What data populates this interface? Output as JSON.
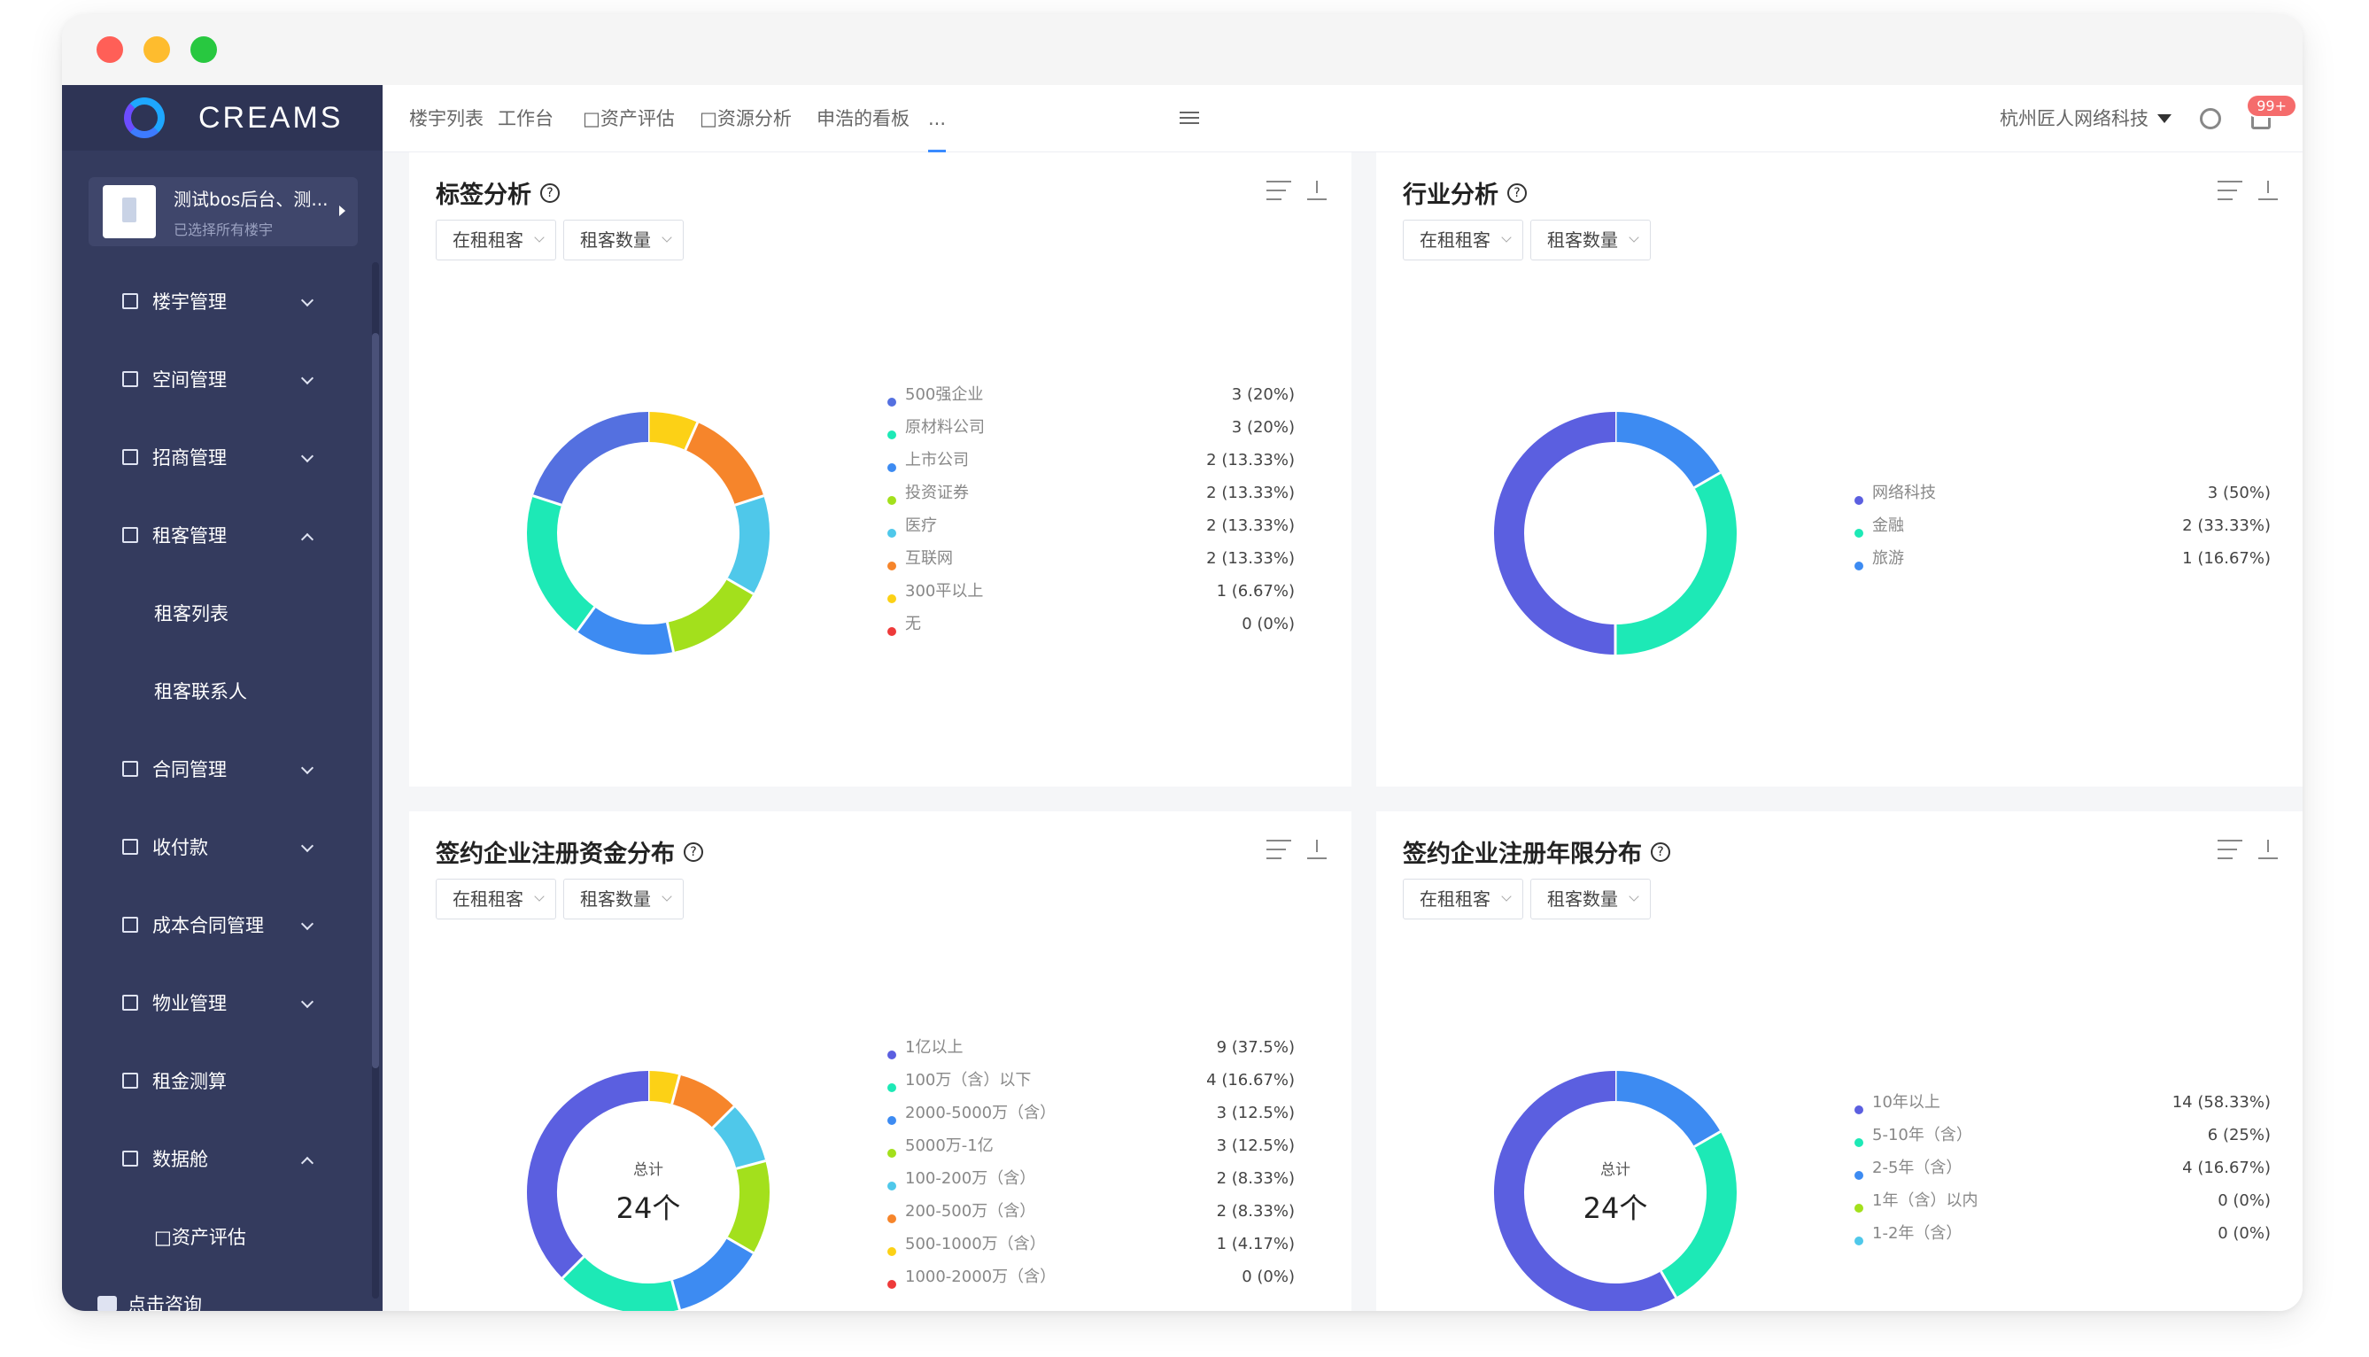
{
  "sidebar": {
    "logo_text": "CREAMS",
    "project_name": "测试bos后台、测...",
    "project_sub": "已选择所有楼宇",
    "items": [
      {
        "label": "楼宇管理",
        "type": "group",
        "expanded": false
      },
      {
        "label": "空间管理",
        "type": "group",
        "expanded": false
      },
      {
        "label": "招商管理",
        "type": "group",
        "expanded": false
      },
      {
        "label": "租客管理",
        "type": "group",
        "expanded": true
      },
      {
        "label": "租客列表",
        "type": "sub"
      },
      {
        "label": "租客联系人",
        "type": "sub"
      },
      {
        "label": "合同管理",
        "type": "group",
        "expanded": false
      },
      {
        "label": "收付款",
        "type": "group",
        "expanded": false
      },
      {
        "label": "成本合同管理",
        "type": "group",
        "expanded": false
      },
      {
        "label": "物业管理",
        "type": "group",
        "expanded": false
      },
      {
        "label": "租金测算",
        "type": "item"
      },
      {
        "label": "数据舱",
        "type": "group",
        "expanded": true
      },
      {
        "label": "□资产评估",
        "type": "sub"
      }
    ],
    "consult_label": "点击咨询"
  },
  "topbar": {
    "tabs": [
      {
        "label": "楼宇列表",
        "active": false
      },
      {
        "label": "工作台",
        "active": false
      },
      {
        "label": "□资产评估",
        "active": false
      },
      {
        "label": "□资源分析",
        "active": false
      },
      {
        "label": "申浩的看板",
        "active": false
      },
      {
        "label": "...",
        "active": true
      }
    ],
    "company": "杭州匠人网络科技",
    "badge": "99+"
  },
  "cards": [
    {
      "title": "标签分析",
      "select1": "在租租客",
      "select2": "租客数量",
      "center_total_label": "",
      "center_total_value": "",
      "legend": [
        {
          "name": "500强企业",
          "value": "3 (20%)",
          "color": "#5470e0"
        },
        {
          "name": "原材料公司",
          "value": "3 (20%)",
          "color": "#1de9b6"
        },
        {
          "name": "上市公司",
          "value": "2 (13.33%)",
          "color": "#3d8bf2"
        },
        {
          "name": "投资证券",
          "value": "2 (13.33%)",
          "color": "#a3e01c"
        },
        {
          "name": "医疗",
          "value": "2 (13.33%)",
          "color": "#4fc8ea"
        },
        {
          "name": "互联网",
          "value": "2 (13.33%)",
          "color": "#f6852b"
        },
        {
          "name": "300平以上",
          "value": "1 (6.67%)",
          "color": "#fcd116"
        },
        {
          "name": "无",
          "value": "0 (0%)",
          "color": "#ee3a3a"
        }
      ]
    },
    {
      "title": "行业分析",
      "select1": "在租租客",
      "select2": "租客数量",
      "center_total_label": "",
      "center_total_value": "",
      "legend": [
        {
          "name": "网络科技",
          "value": "3 (50%)",
          "color": "#5b5fe0"
        },
        {
          "name": "金融",
          "value": "2 (33.33%)",
          "color": "#1de9b6"
        },
        {
          "name": "旅游",
          "value": "1 (16.67%)",
          "color": "#3d8bf2"
        }
      ]
    },
    {
      "title": "签约企业注册资金分布",
      "select1": "在租租客",
      "select2": "租客数量",
      "center_total_label": "总计",
      "center_total_value": "24个",
      "legend": [
        {
          "name": "1亿以上",
          "value": "9 (37.5%)",
          "color": "#5b5fe0"
        },
        {
          "name": "100万（含）以下",
          "value": "4 (16.67%)",
          "color": "#1de9b6"
        },
        {
          "name": "2000-5000万（含）",
          "value": "3 (12.5%)",
          "color": "#3d8bf2"
        },
        {
          "name": "5000万-1亿",
          "value": "3 (12.5%)",
          "color": "#a3e01c"
        },
        {
          "name": "100-200万（含）",
          "value": "2 (8.33%)",
          "color": "#4fc8ea"
        },
        {
          "name": "200-500万（含）",
          "value": "2 (8.33%)",
          "color": "#f6852b"
        },
        {
          "name": "500-1000万（含）",
          "value": "1 (4.17%)",
          "color": "#fcd116"
        },
        {
          "name": "1000-2000万（含）",
          "value": "0 (0%)",
          "color": "#ee3a3a"
        }
      ]
    },
    {
      "title": "签约企业注册年限分布",
      "select1": "在租租客",
      "select2": "租客数量",
      "center_total_label": "总计",
      "center_total_value": "24个",
      "legend": [
        {
          "name": "10年以上",
          "value": "14 (58.33%)",
          "color": "#5b5fe0"
        },
        {
          "name": "5-10年（含）",
          "value": "6 (25%)",
          "color": "#1de9b6"
        },
        {
          "name": "2-5年（含）",
          "value": "4 (16.67%)",
          "color": "#3d8bf2"
        },
        {
          "name": "1年（含）以内",
          "value": "0 (0%)",
          "color": "#a3e01c"
        },
        {
          "name": "1-2年（含）",
          "value": "0 (0%)",
          "color": "#4fc8ea"
        }
      ]
    }
  ],
  "chart_data": [
    {
      "type": "pie",
      "title": "标签分析",
      "categories": [
        "500强企业",
        "原材料公司",
        "上市公司",
        "投资证券",
        "医疗",
        "互联网",
        "300平以上",
        "无"
      ],
      "values": [
        3,
        3,
        2,
        2,
        2,
        2,
        1,
        0
      ],
      "colors": [
        "#5470e0",
        "#1de9b6",
        "#3d8bf2",
        "#a3e01c",
        "#4fc8ea",
        "#f6852b",
        "#fcd116",
        "#ee3a3a"
      ],
      "draw_order": [
        6,
        5,
        4,
        3,
        2,
        1,
        0
      ]
    },
    {
      "type": "pie",
      "title": "行业分析",
      "categories": [
        "网络科技",
        "金融",
        "旅游"
      ],
      "values": [
        3,
        2,
        1
      ],
      "colors": [
        "#5b5fe0",
        "#1de9b6",
        "#3d8bf2"
      ],
      "draw_order": [
        2,
        1,
        0
      ]
    },
    {
      "type": "pie",
      "title": "签约企业注册资金分布",
      "categories": [
        "1亿以上",
        "100万（含）以下",
        "2000-5000万（含）",
        "5000万-1亿",
        "100-200万（含）",
        "200-500万（含）",
        "500-1000万（含）",
        "1000-2000万（含）"
      ],
      "values": [
        9,
        4,
        3,
        3,
        2,
        2,
        1,
        0
      ],
      "colors": [
        "#5b5fe0",
        "#1de9b6",
        "#3d8bf2",
        "#a3e01c",
        "#4fc8ea",
        "#f6852b",
        "#fcd116",
        "#ee3a3a"
      ],
      "draw_order": [
        6,
        5,
        4,
        3,
        2,
        1,
        0
      ]
    },
    {
      "type": "pie",
      "title": "签约企业注册年限分布",
      "categories": [
        "10年以上",
        "5-10年（含）",
        "2-5年（含）",
        "1年（含）以内",
        "1-2年（含）"
      ],
      "values": [
        14,
        6,
        4,
        0,
        0
      ],
      "colors": [
        "#5b5fe0",
        "#1de9b6",
        "#3d8bf2",
        "#a3e01c",
        "#4fc8ea"
      ],
      "draw_order": [
        2,
        1,
        0
      ]
    }
  ]
}
